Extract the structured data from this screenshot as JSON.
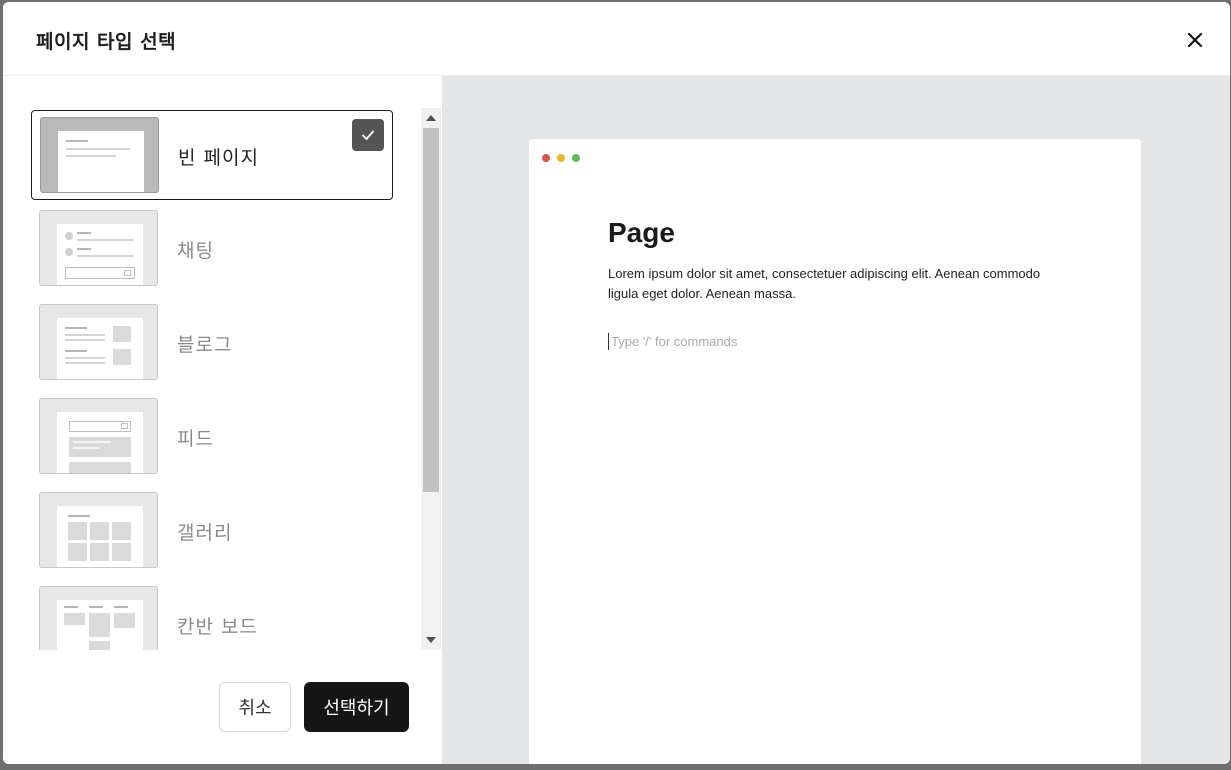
{
  "dialog": {
    "title": "페이지 타입 선택",
    "close_icon": "close-icon"
  },
  "templates": [
    {
      "label": "빈 페이지",
      "selected": true
    },
    {
      "label": "채팅",
      "selected": false
    },
    {
      "label": "블로그",
      "selected": false
    },
    {
      "label": "피드",
      "selected": false
    },
    {
      "label": "갤러리",
      "selected": false
    },
    {
      "label": "칸반 보드",
      "selected": false
    }
  ],
  "footer": {
    "cancel_label": "취소",
    "select_label": "선택하기"
  },
  "preview": {
    "title": "Page",
    "body": "Lorem ipsum dolor sit amet, consectetuer adipiscing elit. Aenean commodo ligula eget dolor. Aenean massa.",
    "input_placeholder": "Type '/' for commands"
  },
  "colors": {
    "primary_button": "#161616",
    "selected_border": "#1a1a1a",
    "preview_bg": "#e5e6e8",
    "traffic_red": "#d9534f",
    "traffic_yellow": "#e6b830",
    "traffic_green": "#5cb85c"
  }
}
